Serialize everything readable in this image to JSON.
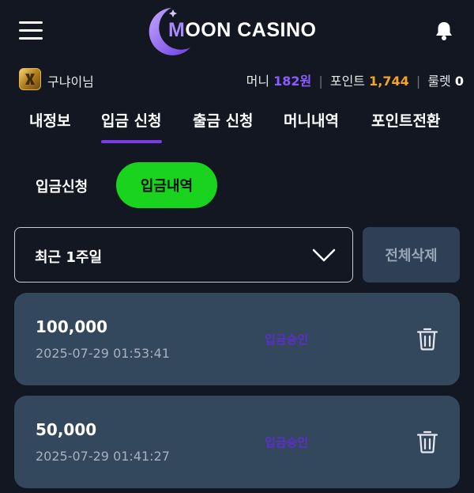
{
  "header": {
    "logo_m": "M",
    "logo_rest": "OON CASINO",
    "menu_icon": "hamburger-icon",
    "bell_icon": "bell-icon"
  },
  "user": {
    "name": "구냐이님",
    "money_label": "머니",
    "money_value": "182원",
    "point_label": "포인트",
    "point_value": "1,744",
    "roulette_label": "룰렛",
    "roulette_value": "0"
  },
  "tabs": [
    {
      "label": "내정보",
      "active": false
    },
    {
      "label": "입금 신청",
      "active": true
    },
    {
      "label": "출금 신청",
      "active": false
    },
    {
      "label": "머니내역",
      "active": false
    },
    {
      "label": "포인트전환",
      "active": false
    }
  ],
  "subtabs": {
    "request": "입금신청",
    "history": "입금내역"
  },
  "filter": {
    "selected": "최근 1주일",
    "delete_all": "전체삭제"
  },
  "records": [
    {
      "amount": "100,000",
      "time": "2025-07-29 01:53:41",
      "status": "입금승인"
    },
    {
      "amount": "50,000",
      "time": "2025-07-29 01:41:27",
      "status": "입금승인"
    }
  ],
  "colors": {
    "background": "#131722",
    "accent_purple": "#7c3aed",
    "accent_green": "#19d31e",
    "point_orange": "#f5a524",
    "card": "#33475d"
  }
}
